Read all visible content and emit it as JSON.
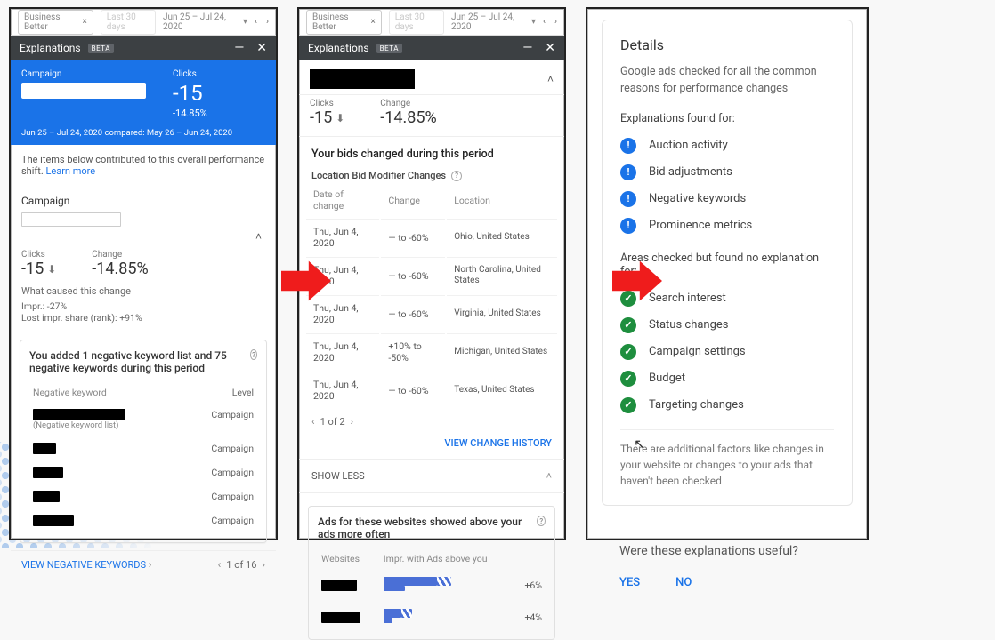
{
  "ga_top": {
    "account_dim": "Business Better",
    "last30": "Last 30 days",
    "date_range": "Jun 25 – Jul 24, 2020"
  },
  "exp_header": {
    "title": "Explanations",
    "beta": "BETA"
  },
  "panel1": {
    "campaign_label": "Campaign",
    "clicks_label": "Clicks",
    "clicks_value": "-15",
    "clicks_pct": "-14.85%",
    "compare": "Jun 25 – Jul 24, 2020 compared: May 26 – Jun 24, 2020",
    "intro": "The items below contributed to this overall performance shift.",
    "learn": "Learn more",
    "section_title": "Campaign",
    "metric_clicks_label": "Clicks",
    "metric_clicks_value": "-15",
    "metric_change_label": "Change",
    "metric_change_value": "-14.85%",
    "cause_label": "What caused this change",
    "cause_items": [
      "Impr.: -27%",
      "Lost impr. share (rank): +91%"
    ],
    "neg_card_title": "You added 1 negative keyword list and 75 negative keywords during this period",
    "neg_table": {
      "cols": [
        "Negative keyword",
        "Level"
      ],
      "row_subtext": "(Negative keyword list)",
      "rows": [
        {
          "level": "Campaign"
        },
        {
          "level": "Campaign"
        },
        {
          "level": "Campaign"
        },
        {
          "level": "Campaign"
        },
        {
          "level": "Campaign"
        }
      ]
    },
    "view_link": "VIEW NEGATIVE KEYWORDS",
    "pager": "1 of 16"
  },
  "panel2": {
    "clicks_label": "Clicks",
    "clicks_value": "-15",
    "change_label": "Change",
    "change_value": "-14.85%",
    "bids_title": "Your bids changed during this period",
    "loc_title": "Location Bid Modifier Changes",
    "table": {
      "cols": [
        "Date of change",
        "Change",
        "Location"
      ],
      "rows": [
        {
          "date": "Thu, Jun 4, 2020",
          "chg": "— to -60%",
          "loc": "Ohio, United States"
        },
        {
          "date": "Thu, Jun 4, 2020",
          "chg": "— to -60%",
          "loc": "North Carolina, United States"
        },
        {
          "date": "Thu, Jun 4, 2020",
          "chg": "— to -60%",
          "loc": "Virginia, United States"
        },
        {
          "date": "Thu, Jun 4, 2020",
          "chg": "+10% to -50%",
          "loc": "Michigan, United States"
        },
        {
          "date": "Thu, Jun 4, 2020",
          "chg": "— to -60%",
          "loc": "Texas, United States"
        }
      ]
    },
    "pager": "1 of 2",
    "view_history": "VIEW CHANGE HISTORY",
    "show_less": "SHOW LESS",
    "ads_title": "Ads for these websites showed above your ads more often",
    "ads_cols": [
      "Websites",
      "Impr. with Ads above you"
    ],
    "ads_rows": [
      {
        "pct": "+6%",
        "bar_main": 60,
        "bar_stripe": 16,
        "bar_sec": 24
      },
      {
        "pct": "+4%",
        "bar_main": 20,
        "bar_stripe": 12,
        "bar_sec": 10
      }
    ]
  },
  "panel3": {
    "title": "Details",
    "lead": "Google ads checked for all the common reasons for performance changes",
    "found_label": "Explanations found for:",
    "found": [
      "Auction activity",
      "Bid adjustments",
      "Negative keywords",
      "Prominence metrics"
    ],
    "none_label": "Areas checked but found no explanation for:",
    "none": [
      "Search interest",
      "Status changes",
      "Campaign settings",
      "Budget",
      "Targeting changes"
    ],
    "footnote": "There are additional factors like changes in your website or changes to your ads that haven't been checked",
    "question": "Were these explanations useful?",
    "yes": "YES",
    "no": "NO"
  }
}
